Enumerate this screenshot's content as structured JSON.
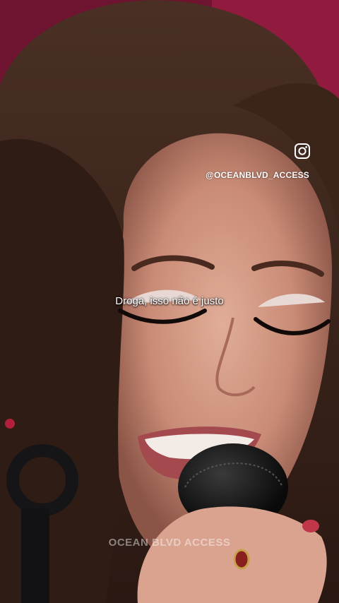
{
  "overlay": {
    "instagram_icon": "instagram-icon",
    "handle": "@OCEANBLVD_ACCESS",
    "subtitle": "Droga, isso não é justo",
    "watermark": "OCEAN BLVD ACCESS"
  },
  "colors": {
    "text": "#ffffff",
    "backdrop": "#8c1a3a",
    "hair": "#3a2418",
    "skin": "#d9a18e",
    "microphone": "#111111"
  }
}
